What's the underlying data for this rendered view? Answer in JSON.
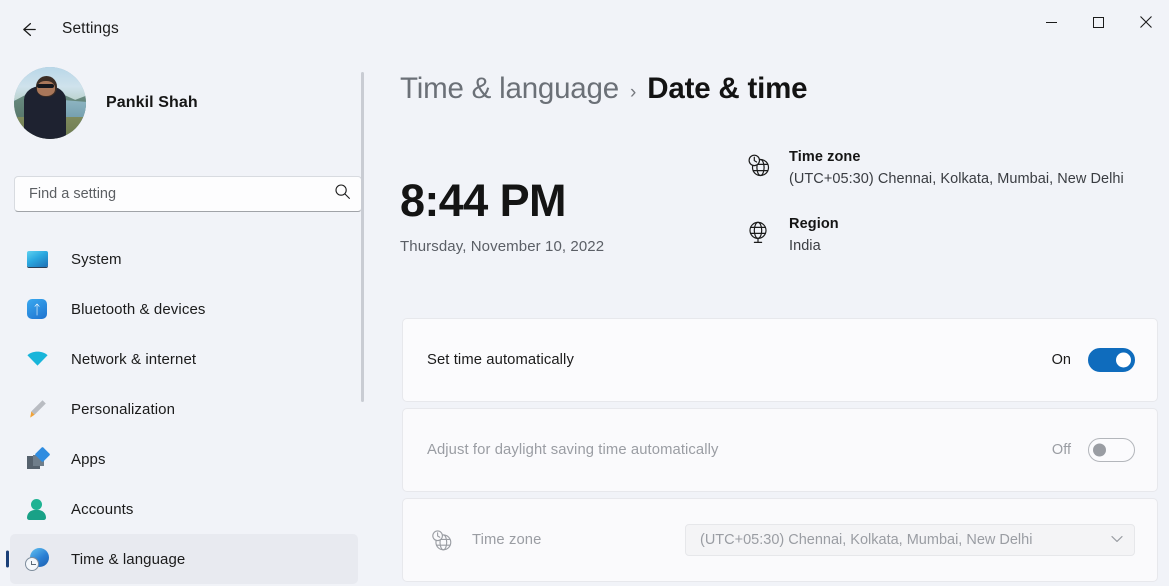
{
  "window": {
    "title": "Settings",
    "back_icon": "back-arrow-icon",
    "minimize_label": "—",
    "maximize_label": "□",
    "close_label": "✕"
  },
  "sidebar": {
    "profile": {
      "name": "Pankil Shah",
      "avatar_icon": "user-avatar-photo"
    },
    "search": {
      "placeholder": "Find a setting",
      "value": "",
      "icon": "search-icon"
    },
    "items": [
      {
        "label": "System",
        "icon": "monitor-icon",
        "selected": false
      },
      {
        "label": "Bluetooth & devices",
        "icon": "bluetooth-icon",
        "selected": false
      },
      {
        "label": "Network & internet",
        "icon": "wifi-icon",
        "selected": false
      },
      {
        "label": "Personalization",
        "icon": "paintbrush-icon",
        "selected": false
      },
      {
        "label": "Apps",
        "icon": "apps-squares-icon",
        "selected": false
      },
      {
        "label": "Accounts",
        "icon": "person-icon",
        "selected": false
      },
      {
        "label": "Time & language",
        "icon": "globe-clock-icon",
        "selected": true
      }
    ]
  },
  "main": {
    "breadcrumb": {
      "parent": "Time & language",
      "separator": "›",
      "current": "Date & time"
    },
    "clock": {
      "time": "8:44 PM",
      "date": "Thursday, November 10, 2022"
    },
    "info": [
      {
        "icon": "globe-clock-icon",
        "title": "Time zone",
        "value": "(UTC+05:30) Chennai, Kolkata, Mumbai, New Delhi"
      },
      {
        "icon": "globe-icon",
        "title": "Region",
        "value": "India"
      }
    ],
    "settings": [
      {
        "label": "Set time automatically",
        "state": "On",
        "toggle": "on",
        "disabled": false
      },
      {
        "label": "Adjust for daylight saving time automatically",
        "state": "Off",
        "toggle": "off",
        "disabled": true
      }
    ],
    "timezone_row": {
      "icon": "globe-clock-icon",
      "label": "Time zone",
      "dropdown_value": "(UTC+05:30) Chennai, Kolkata, Mumbai, New Delhi",
      "chevron": "⌄"
    }
  },
  "colors": {
    "accent": "#0f6cbd",
    "selected_bar": "#1a3f78",
    "page_bg": "#f1f3f8",
    "card_bg": "#fbfbfd"
  }
}
